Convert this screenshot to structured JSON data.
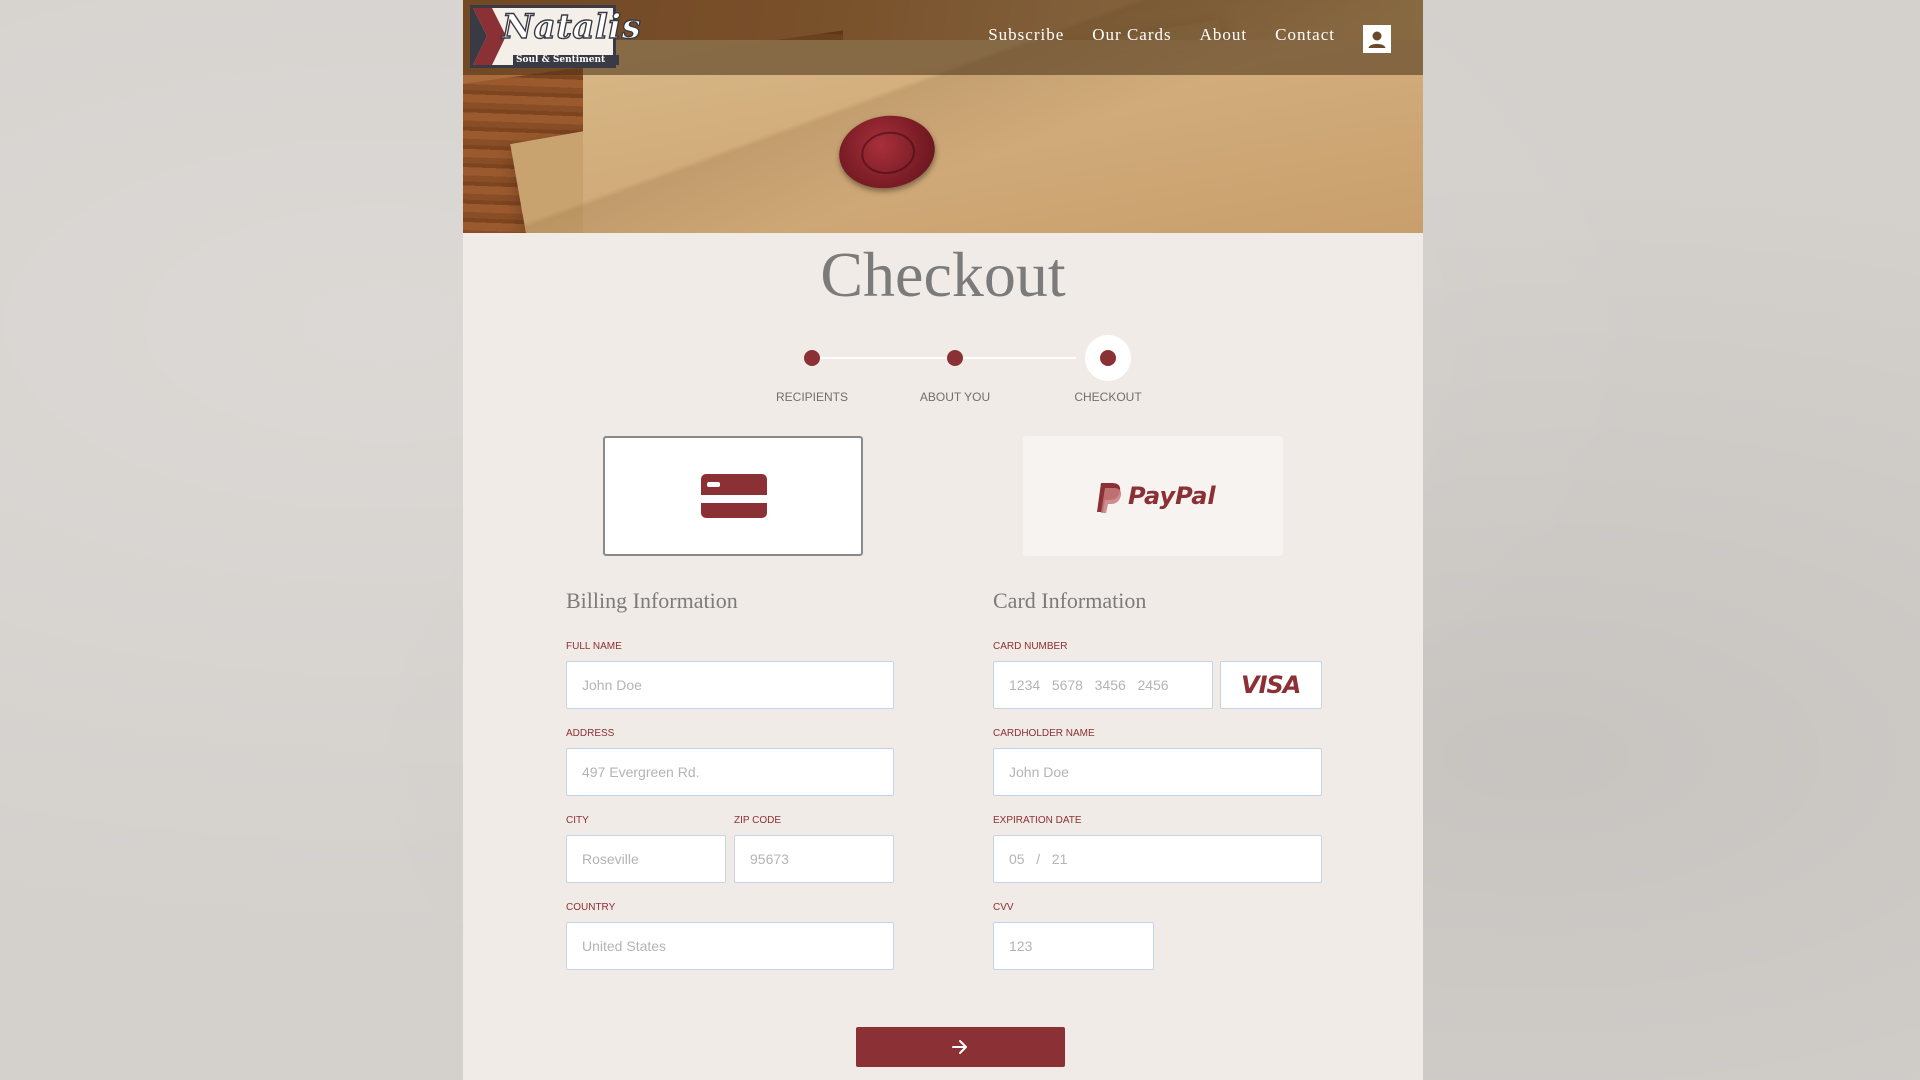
{
  "brand": {
    "name": "Natalis",
    "tagline": "Soul & Sentiment"
  },
  "nav": {
    "items": [
      "Subscribe",
      "Our Cards",
      "About",
      "Contact"
    ],
    "account_icon": "user-icon"
  },
  "page": {
    "title": "Checkout"
  },
  "stepper": {
    "steps": [
      "RECIPIENTS",
      "ABOUT YOU",
      "CHECKOUT"
    ],
    "active": "CHECKOUT"
  },
  "payment_methods": {
    "card_icon": "credit-card-icon",
    "paypal_label": "PayPal",
    "selected": "card"
  },
  "billing": {
    "heading": "Billing Information",
    "full_name": {
      "label": "FULL NAME",
      "placeholder": "John Doe"
    },
    "address": {
      "label": "ADDRESS",
      "placeholder": "497 Evergreen Rd."
    },
    "city": {
      "label": "CITY",
      "placeholder": "Roseville"
    },
    "zip": {
      "label": "ZIP CODE",
      "placeholder": "95673"
    },
    "country": {
      "label": "COUNTRY",
      "placeholder": "United States"
    }
  },
  "card": {
    "heading": "Card Information",
    "number": {
      "label": "CARD NUMBER",
      "placeholder": "1234   5678   3456   2456"
    },
    "brand": "VISA",
    "holder": {
      "label": "CARDHOLDER NAME",
      "placeholder": "John Doe"
    },
    "expiry": {
      "label": "EXPIRATION DATE",
      "placeholder": "05   /   21"
    },
    "cvv": {
      "label": "CVV",
      "placeholder": "123"
    }
  },
  "actions": {
    "next_icon": "arrow-right-icon"
  },
  "colors": {
    "accent": "#8b3034",
    "page_bg": "#f0ebe6",
    "outer_bg": "#d4d0cc",
    "heading": "#7b7b7b"
  }
}
